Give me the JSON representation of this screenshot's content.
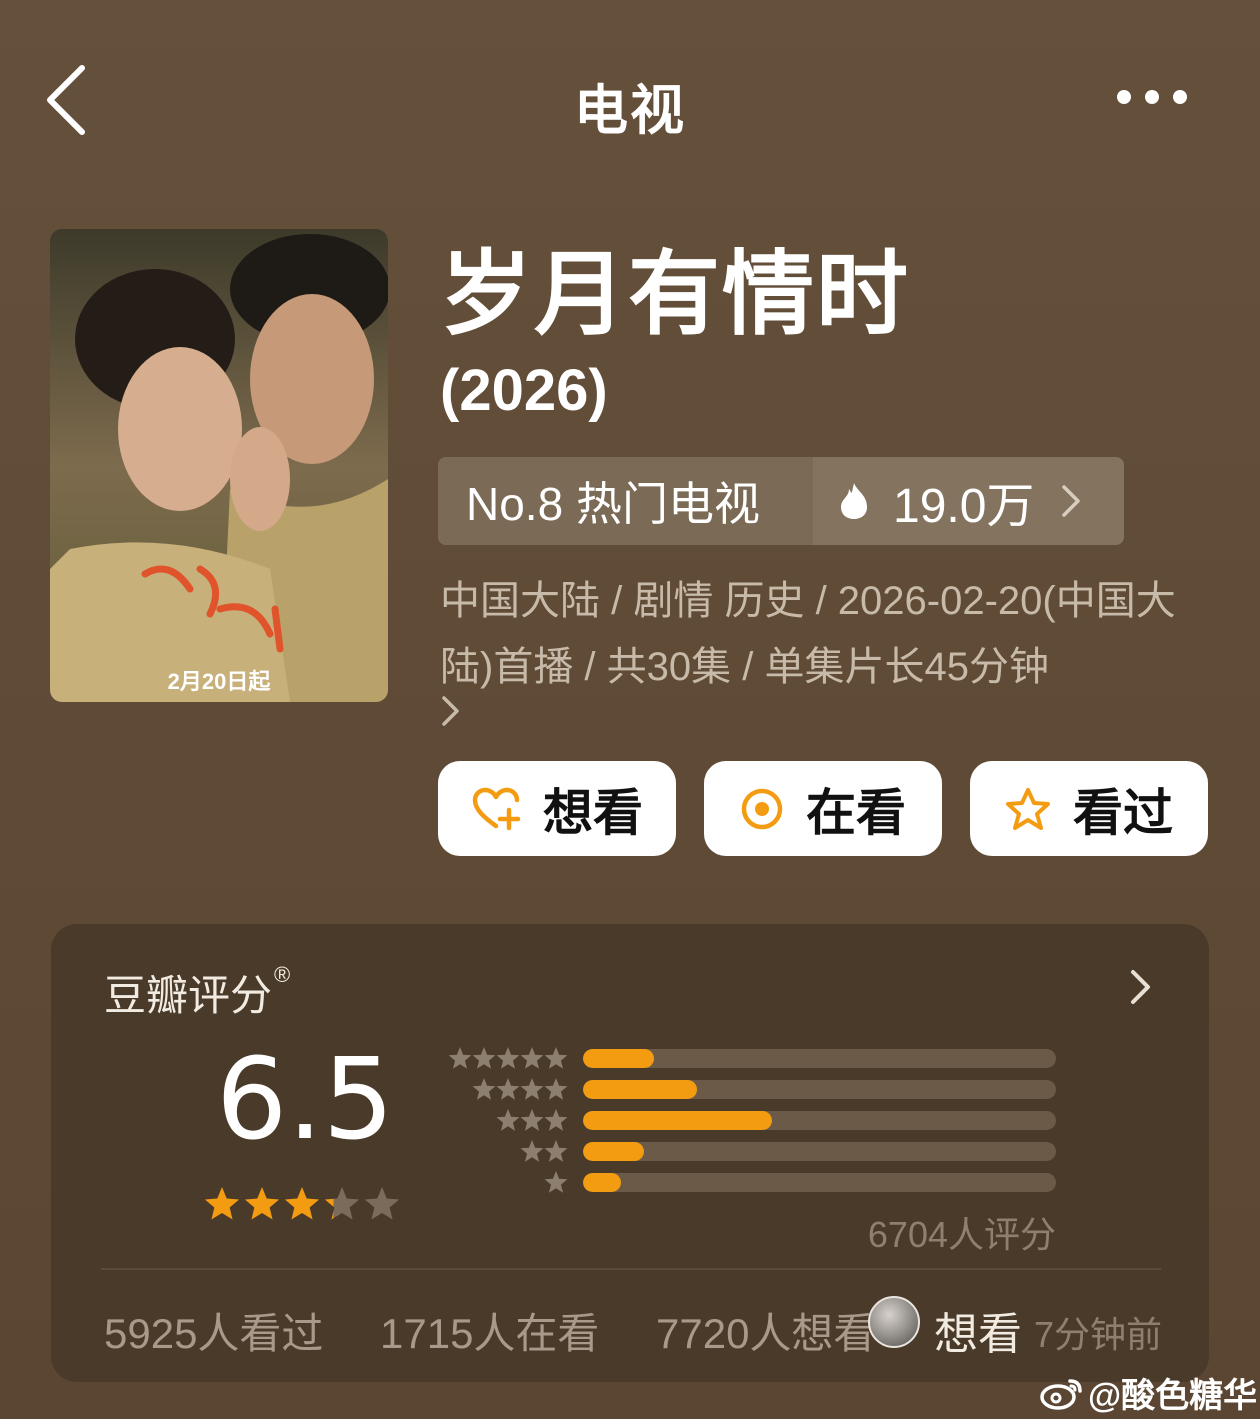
{
  "header": {
    "title": "电视"
  },
  "poster": {
    "caption": "2月20日起"
  },
  "show": {
    "title": "岁月有情时",
    "year": "(2026)"
  },
  "rank": {
    "label": "No.8 热门电视",
    "heat": "19.0万"
  },
  "meta": {
    "text": "中国大陆 / 剧情 历史 / 2026-02-20(中国大陆)首播 / 共30集 / 单集片长45分钟"
  },
  "actions": {
    "want": "想看",
    "watching": "在看",
    "watched": "看过"
  },
  "rating": {
    "label": "豆瓣评分",
    "mark": "®",
    "score": "6.5",
    "stars_value": 3.25,
    "count_text": "6704人评分",
    "distribution": [
      {
        "stars": 5,
        "fraction": 0.15
      },
      {
        "stars": 4,
        "fraction": 0.24
      },
      {
        "stars": 3,
        "fraction": 0.4
      },
      {
        "stars": 2,
        "fraction": 0.13
      },
      {
        "stars": 1,
        "fraction": 0.08
      }
    ]
  },
  "stats": {
    "watched": "5925人看过",
    "watching": "1715人在看",
    "want": "7720人想看"
  },
  "feed": {
    "action": "想看",
    "time": "7分钟前"
  },
  "watermark": {
    "text": "@酸色糖华"
  },
  "colors": {
    "accent": "#f39c12",
    "card": "#4a3a29",
    "track": "#6b5a47"
  }
}
